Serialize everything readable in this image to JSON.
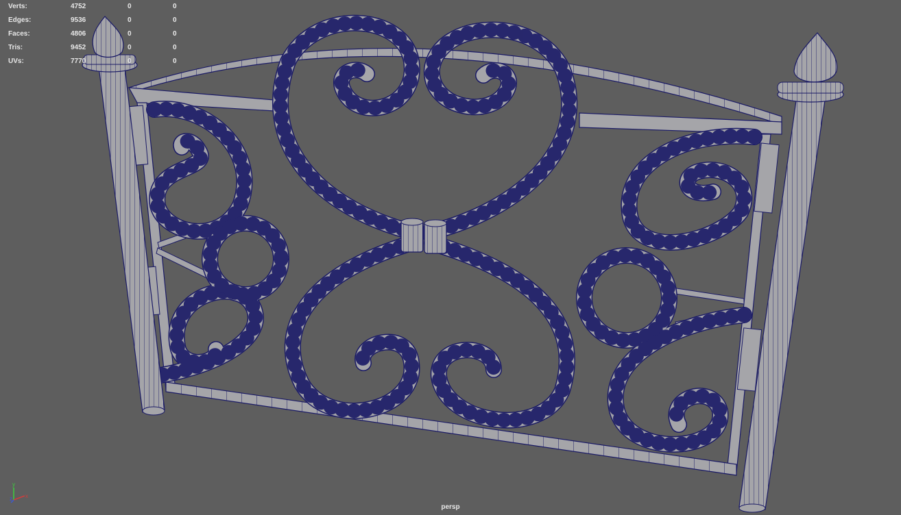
{
  "viewport": {
    "camera": "persp",
    "background_color": "#5e5e5e",
    "mesh_fill_color": "#a5a5a9",
    "wire_color": "#1a1a66"
  },
  "hud": {
    "rows": [
      {
        "label": "Verts:",
        "total": "4752",
        "selected": "0",
        "component": "0"
      },
      {
        "label": "Edges:",
        "total": "9536",
        "selected": "0",
        "component": "0"
      },
      {
        "label": "Faces:",
        "total": "4806",
        "selected": "0",
        "component": "0"
      },
      {
        "label": "Tris:",
        "total": "9452",
        "selected": "0",
        "component": "0"
      },
      {
        "label": "UVs:",
        "total": "7770",
        "selected": "0",
        "component": "0"
      }
    ]
  },
  "axis_gizmo": {
    "y_label": "y",
    "z_label": "z",
    "x_label": "x",
    "x_color": "#d23c3c",
    "y_color": "#3cd23c",
    "z_color": "#3c5ad2"
  }
}
